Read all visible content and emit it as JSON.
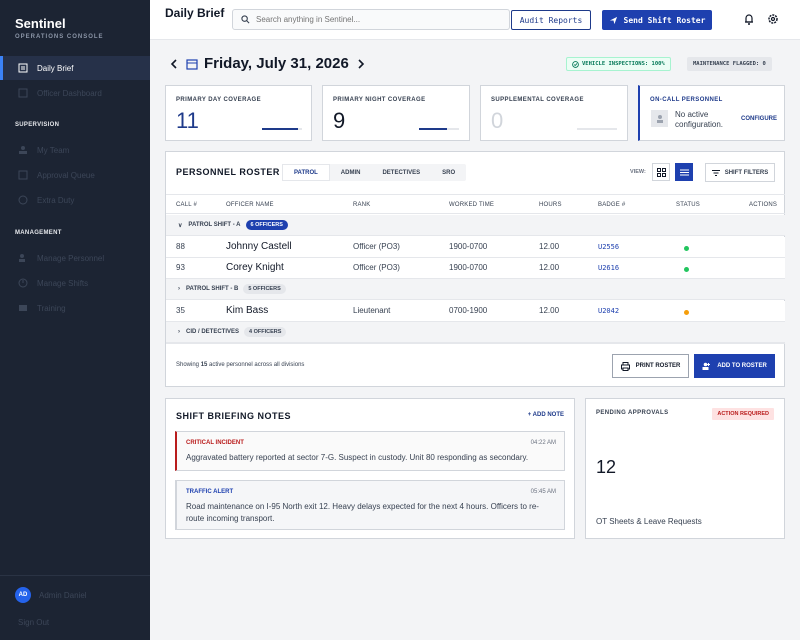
{
  "sidebar": {
    "brand": "Sentinel",
    "brand_sub": "OPERATIONS CONSOLE",
    "items": [
      {
        "label": "Daily Brief"
      },
      {
        "label": "Officer Dashboard"
      }
    ],
    "section_supervision": "SUPERVISION",
    "supervision_items": [
      {
        "label": "My Team"
      },
      {
        "label": "Approval Queue"
      },
      {
        "label": "Extra Duty"
      }
    ],
    "section_management": "MANAGEMENT",
    "management_items": [
      {
        "label": "Manage Personnel"
      },
      {
        "label": "Manage Shifts"
      },
      {
        "label": "Training"
      }
    ],
    "user_initials": "AD",
    "user_name": "Admin Daniel",
    "signout": "Sign Out"
  },
  "header": {
    "title": "Daily Brief",
    "search_placeholder": "Search anything in Sentinel...",
    "audit_label": "Audit Reports",
    "send_label": "Send Shift Roster"
  },
  "date_bar": {
    "date": "Friday, July 31, 2026",
    "vehicle_badge": "VEHICLE INSPECTIONS: 100%",
    "maintenance_badge": "MAINTENANCE FLAGGED: 0"
  },
  "stats": {
    "day_label": "PRIMARY DAY COVERAGE",
    "day_value": "11",
    "day_fill": 0.9,
    "night_label": "PRIMARY NIGHT COVERAGE",
    "night_value": "9",
    "night_fill": 0.7,
    "supp_label": "SUPPLEMENTAL COVERAGE",
    "supp_value": "0",
    "supp_fill": 0,
    "oncall_label": "ON-CALL PERSONNEL",
    "oncall_text": "No active configuration.",
    "oncall_action": "CONFIGURE"
  },
  "roster": {
    "title": "PERSONNEL ROSTER",
    "tabs": [
      "PATROL",
      "ADMIN",
      "DETECTIVES",
      "SRO"
    ],
    "view_label": "VIEW:",
    "filter_label": "SHIFT FILTERS",
    "columns": [
      "CALL #",
      "OFFICER NAME",
      "RANK",
      "WORKED TIME",
      "HOURS",
      "BADGE #",
      "STATUS",
      "ACTIONS"
    ],
    "groups": [
      {
        "label": "PATROL SHIFT - A",
        "count": "6 OFFICERS"
      },
      {
        "label": "PATROL SHIFT - B",
        "count": "5 OFFICERS"
      },
      {
        "label": "CID / DETECTIVES",
        "count": "4 OFFICERS"
      }
    ],
    "rows": [
      {
        "call": "88",
        "name": "Johnny Castell",
        "rank": "Officer (PO3)",
        "time": "1900-0700",
        "hours": "12.00",
        "badge": "U2556",
        "status_color": "#22c55e"
      },
      {
        "call": "93",
        "name": "Corey Knight",
        "rank": "Officer (PO3)",
        "time": "1900-0700",
        "hours": "12.00",
        "badge": "U2616",
        "status_color": "#22c55e"
      },
      {
        "call": "35",
        "name": "Kim Bass",
        "rank": "Lieutenant",
        "time": "0700-1900",
        "hours": "12.00",
        "badge": "U2042",
        "status_color": "#f59e0b"
      }
    ],
    "footer_prefix": "Showing ",
    "footer_count": "15",
    "footer_suffix": " active personnel across all divisions",
    "print_label": "PRINT ROSTER",
    "add_label": "ADD TO ROSTER"
  },
  "notes": {
    "title": "SHIFT BRIEFING NOTES",
    "add_label": "+ ADD NOTE",
    "items": [
      {
        "tag": "CRITICAL INCIDENT",
        "time": "04:22 AM",
        "body": "Aggravated battery reported at sector 7-G. Suspect in custody. Unit 80 responding as secondary."
      },
      {
        "tag": "TRAFFIC ALERT",
        "time": "05:45 AM",
        "body": "Road maintenance on I-95 North exit 12. Heavy delays expected for the next 4 hours. Officers to re-route incoming transport."
      }
    ]
  },
  "pending": {
    "label": "PENDING APPROVALS",
    "badge": "ACTION REQUIRED",
    "value": "12",
    "sub": "OT Sheets & Leave Requests"
  },
  "colors": {
    "accent": "#1e40af",
    "sidebar_bg": "#1c2433",
    "critical": "#b91c1c",
    "traffic": "#1e40af"
  }
}
